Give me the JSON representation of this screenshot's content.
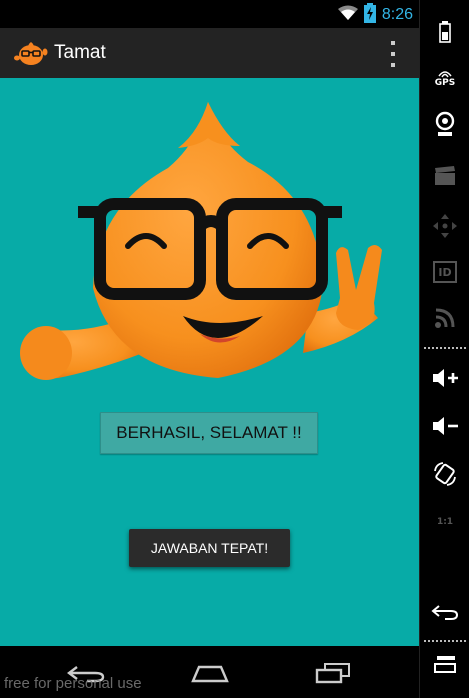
{
  "status_bar": {
    "time": "8:26",
    "icons": [
      "wifi-icon",
      "battery-charging-icon"
    ],
    "accent_color": "#33b5e5"
  },
  "action_bar": {
    "title": "Tamat",
    "icon": "app-mascot-icon",
    "menu_icon": "overflow-menu-icon"
  },
  "content": {
    "background_color": "#07aba7",
    "image": "mascot-with-glasses-illustration",
    "result_label": "BERHASIL, SELAMAT !!",
    "toast": "JAWABAN TEPAT!"
  },
  "nav_bar": {
    "buttons": [
      "back-icon",
      "home-icon",
      "recent-apps-icon"
    ],
    "watermark": "free for personal use"
  },
  "side_panel": {
    "buttons": [
      "battery-icon",
      "gps-icon",
      "webcam-icon",
      "clapperboard-icon",
      "move-icon",
      "id-icon",
      "rss-icon",
      "volume-up-icon",
      "volume-down-icon",
      "rotate-icon",
      "scale-icon",
      "back-icon",
      "menu-icon"
    ],
    "gps_label": "GPS",
    "id_label": "ID",
    "scale_label": "1:1"
  }
}
